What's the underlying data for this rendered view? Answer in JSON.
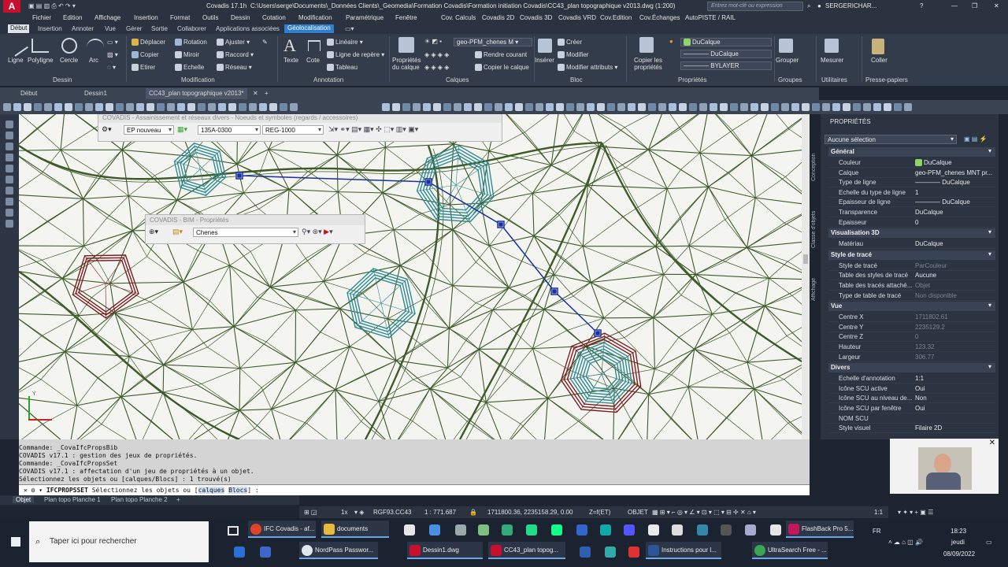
{
  "title": {
    "app": "Covadis 17.1h",
    "path": "C:\\Users\\serge\\Documents\\_Données Clients\\_Geomedia\\Formation Covadis\\Formation initiation Covadis\\CC43_plan topographique v2013.dwg (1:200)",
    "search_placeholder": "Entrez mot-clé ou expression",
    "user": "SERGERICHAR..."
  },
  "menu": [
    "Fichier",
    "Edition",
    "Affichage",
    "Insertion",
    "Format",
    "Outils",
    "Dessin",
    "Cotation",
    "Modification",
    "Paramétrique",
    "Fenêtre",
    "Cov. Calculs",
    "Covadis 2D",
    "Covadis 3D",
    "Covadis VRD",
    "Cov.Edition",
    "Cov.Échanges",
    "AutoPISTE / RAIL"
  ],
  "ribbon_tabs": [
    "Début",
    "Insertion",
    "Annoter",
    "Vue",
    "Gérer",
    "Sortie",
    "Collaborer",
    "Applications associées",
    "Géolocalisation"
  ],
  "ribbon": {
    "draw": [
      "Ligne",
      "Polyligne",
      "Cercle",
      "Arc"
    ],
    "modify": [
      "Déplacer",
      "Rotation",
      "Ajuster",
      "Copier",
      "Miroir",
      "Raccord",
      "Etirer",
      "Echelle",
      "Réseau"
    ],
    "annotation": [
      "Texte",
      "Cote",
      "Linéaire",
      "Ligne de repère",
      "Tableau"
    ],
    "layer_props": "Propriétés du calque",
    "layer_name": "geo-PFM_chenes M",
    "layer_tools": [
      "Rendre courant",
      "Copier le calque"
    ],
    "insert": "Insérer",
    "block": [
      "Créer",
      "Modifier",
      "Modifier attributs"
    ],
    "copy_props": "Copier les propriétés",
    "prop_values": [
      "DuCalque",
      "DuCalque",
      "BYLAYER"
    ],
    "group": "Grouper",
    "measure": "Mesurer",
    "paste": "Coller",
    "groups": [
      "Dessin",
      "Modification",
      "Annotation",
      "Calques",
      "Bloc",
      "Propriétés",
      "Groupes",
      "Utilitaires",
      "Presse-papiers"
    ]
  },
  "doc_tabs": [
    "Début",
    "Dessin1",
    "CC43_plan topographique v2013*"
  ],
  "panels": {
    "assain": {
      "title": "COVADIS - Assainissement et réseaux divers - Noeuds et symboles (regards / accessoires)",
      "dd1": "EP nouveau",
      "dd2": "135A-0300",
      "dd3": "REG-1000"
    },
    "bim": {
      "title": "COVADIS - BIM - Propriétés",
      "dd": "Chenes"
    }
  },
  "command_history": [
    "Commande: _CovaIfcPropsBib",
    "COVADIS v17.1 : gestion des jeux de propriétés.",
    "Commande: _CovaIfcPropsSet",
    "COVADIS v17.1 : affectation d'un jeu de propriétés à un objet.",
    "Sélectionnez les objets ou [calques/Blocs] : 1 trouvé(s)"
  ],
  "command_line": {
    "cmd": "IFCPROPSSET",
    "prompt": "Sélectionnez les objets ou [",
    "opt1": "calques",
    "opt2": "Blocs",
    "end": "] :"
  },
  "layout_tabs": [
    "Objet",
    "Plan topo Planche 1",
    "Plan topo Planche 2"
  ],
  "status": {
    "scale": "1x",
    "crs": "RGF93.CC43",
    "ratio": "1 : 771.687",
    "coords": "1711800.36, 2235158.29, 0.00",
    "z": "Z=f(ET)",
    "mode": "OBJET",
    "annot": "1:1"
  },
  "properties": {
    "title": "PROPRIÉTÉS",
    "selection": "Aucune sélection",
    "side_tabs": [
      "Conception",
      "Classe d'objets",
      "Affichage"
    ],
    "sections": [
      {
        "name": "Général",
        "rows": [
          [
            "Couleur",
            "DuCalque"
          ],
          [
            "Calque",
            "geo-PFM_chenes MNT pr..."
          ],
          [
            "Type de ligne",
            "DuCalque"
          ],
          [
            "Echelle du type de ligne",
            "1"
          ],
          [
            "Epaisseur de ligne",
            "DuCalque"
          ],
          [
            "Transparence",
            "DuCalque"
          ],
          [
            "Epaisseur",
            "0"
          ]
        ]
      },
      {
        "name": "Visualisation 3D",
        "rows": [
          [
            "Matériau",
            "DuCalque"
          ]
        ]
      },
      {
        "name": "Style de tracé",
        "rows": [
          [
            "Style de tracé",
            "ParCouleur"
          ],
          [
            "Table des styles de tracé",
            "Aucune"
          ],
          [
            "Table des tracés attaché...",
            "Objet"
          ],
          [
            "Type de table de tracé",
            "Non disponible"
          ]
        ]
      },
      {
        "name": "Vue",
        "rows": [
          [
            "Centre X",
            "1711802.61"
          ],
          [
            "Centre Y",
            "2235129.2"
          ],
          [
            "Centre Z",
            "0"
          ],
          [
            "Hauteur",
            "123.32"
          ],
          [
            "Largeur",
            "306.77"
          ]
        ]
      },
      {
        "name": "Divers",
        "rows": [
          [
            "Echelle d'annotation",
            "1:1"
          ],
          [
            "Icône SCU active",
            "Oui"
          ],
          [
            "Icône SCU au niveau de...",
            "Non"
          ],
          [
            "Icône SCU par fenêtre",
            "Oui"
          ],
          [
            "NOM SCU",
            ""
          ],
          [
            "Style visuel",
            "Filaire 2D"
          ]
        ]
      }
    ]
  },
  "taskbar": {
    "search": "Taper ici pour rechercher",
    "apps_top": [
      "IFC Covadis - af...",
      "documents",
      "FlashBack Pro 5..."
    ],
    "apps_bottom": [
      "NordPass Passwor...",
      "Dessin1.dwg",
      "CC43_plan topog...",
      "Instructions pour l...",
      "UltraSearch Free - ..."
    ],
    "lang": "FR",
    "time": "18:23",
    "day": "jeudi",
    "date": "08/09/2022"
  },
  "colors": {
    "accent": "#2f7fd0",
    "canvas": "#f4f5f1",
    "mesh": "#3e5a2a",
    "teal": "#2f8a92",
    "red": "#7a1e22",
    "blue": "#1a2fa0"
  }
}
